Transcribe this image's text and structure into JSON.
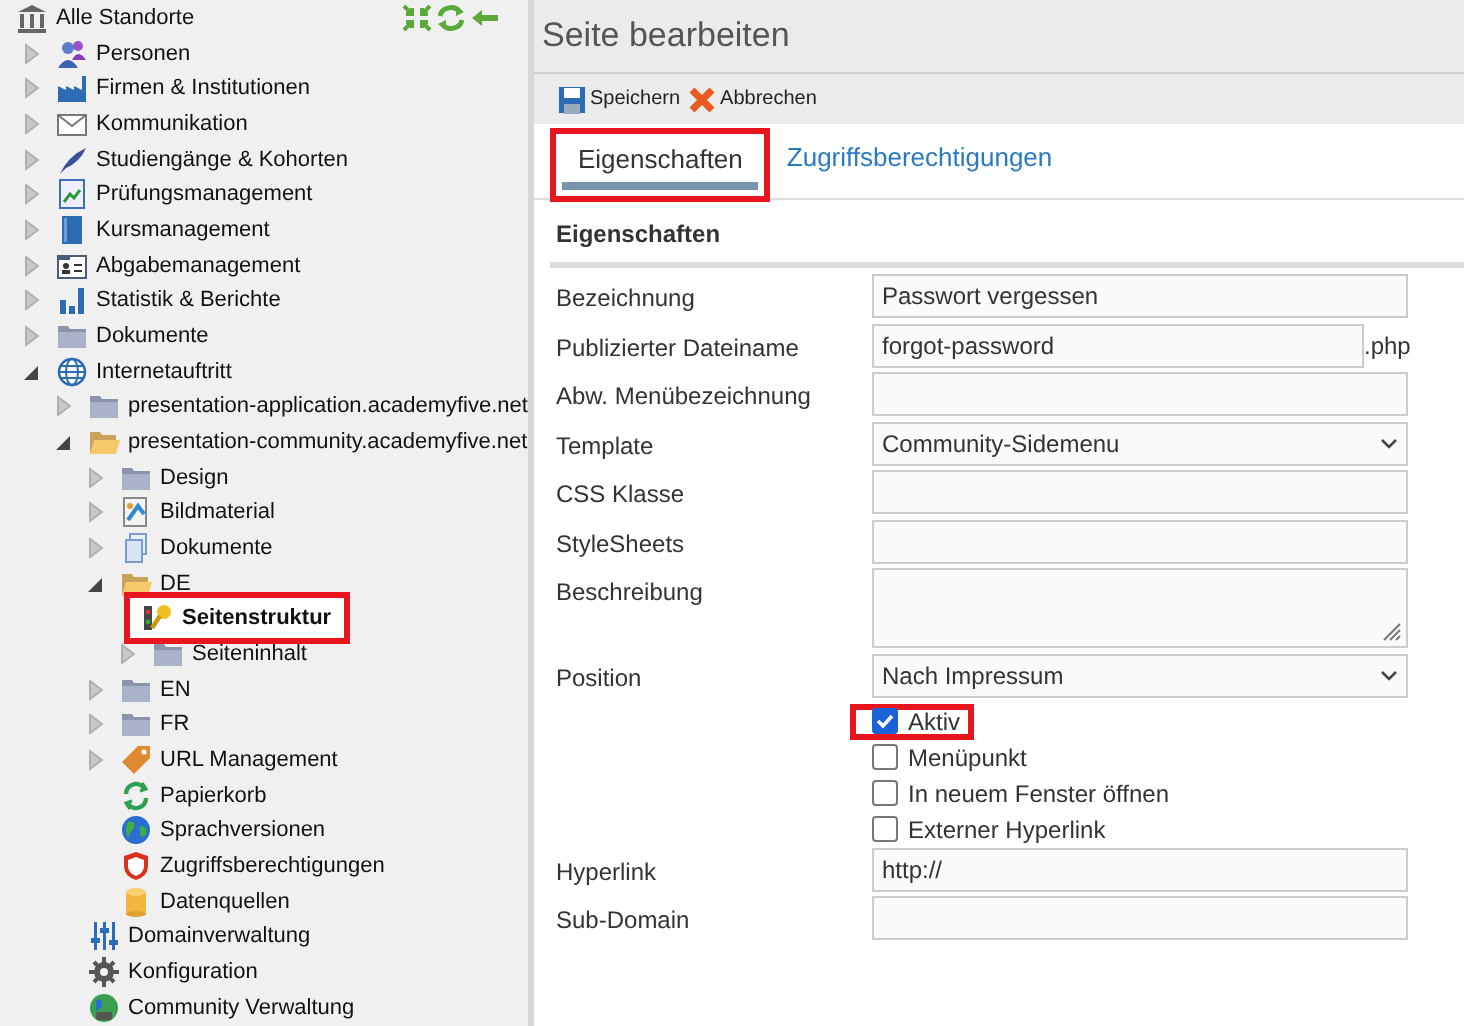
{
  "tree": {
    "label": "Alle Standorte",
    "children": [
      {
        "label": "Personen",
        "expanded": false
      },
      {
        "label": "Firmen & Institutionen",
        "expanded": false
      },
      {
        "label": "Kommunikation",
        "expanded": false
      },
      {
        "label": "Studiengänge & Kohorten",
        "expanded": false
      },
      {
        "label": "Prüfungsmanagement",
        "expanded": false
      },
      {
        "label": "Kursmanagement",
        "expanded": false
      },
      {
        "label": "Abgabemanagement",
        "expanded": false
      },
      {
        "label": "Statistik & Berichte",
        "expanded": false
      },
      {
        "label": "Dokumente",
        "expanded": false
      },
      {
        "label": "Internetauftritt",
        "expanded": true,
        "children": [
          {
            "label": "presentation-application.academyfive.net",
            "expanded": false
          },
          {
            "label": "presentation-community.academyfive.net",
            "expanded": true,
            "children": [
              {
                "label": "Design",
                "expanded": false
              },
              {
                "label": "Bildmaterial",
                "expanded": false
              },
              {
                "label": "Dokumente",
                "expanded": false
              },
              {
                "label": "DE",
                "expanded": true,
                "children": [
                  {
                    "label": "Seitenstruktur",
                    "selected": true,
                    "highlighted": true
                  },
                  {
                    "label": "Seiteninhalt",
                    "selected": false,
                    "expanded": false
                  }
                ]
              },
              {
                "label": "EN",
                "expanded": false
              },
              {
                "label": "FR",
                "expanded": false
              },
              {
                "label": "URL Management",
                "expanded": false
              },
              {
                "label": "Papierkorb"
              },
              {
                "label": "Sprachversionen"
              },
              {
                "label": "Zugriffsberechtigungen"
              },
              {
                "label": "Datenquellen"
              }
            ]
          },
          {
            "label": "Domainverwaltung"
          },
          {
            "label": "Konfiguration"
          },
          {
            "label": "Community Verwaltung"
          }
        ]
      }
    ]
  },
  "title": "Seite bearbeiten",
  "toolbar": [
    "Speichern",
    "Abbrechen"
  ],
  "tabs": [
    {
      "label": "Eigenschaften",
      "selected": true,
      "highlighted": true
    },
    {
      "label": "Zugriffsberechtigungen",
      "selected": false,
      "highlighted": false
    }
  ],
  "section_title": "Eigenschaften",
  "fields": [
    {
      "kind": "text",
      "label": "Bezeichnung",
      "value": "Passwort vergessen"
    },
    {
      "kind": "text",
      "label": "Publizierter Dateiname",
      "value": "forgot-password",
      "suffix": ".php"
    },
    {
      "kind": "text",
      "label": "Abw. Menübezeichnung"
    },
    {
      "kind": "select",
      "label": "Template",
      "value": "Community-Sidemenu"
    },
    {
      "kind": "text",
      "label": "CSS Klasse"
    },
    {
      "kind": "text",
      "label": "StyleSheets"
    },
    {
      "kind": "textarea",
      "label": "Beschreibung"
    },
    {
      "kind": "select",
      "label": "Position",
      "value": "Nach Impressum"
    },
    {
      "kind": "checkboxes",
      "options": [
        {
          "label": "Aktiv",
          "checked": true,
          "highlighted": true
        },
        {
          "label": "Menüpunkt",
          "checked": false,
          "highlighted": false
        },
        {
          "label": "In neuem Fenster öffnen",
          "checked": false,
          "highlighted": false
        },
        {
          "label": "Externer Hyperlink",
          "checked": false,
          "highlighted": false
        }
      ]
    },
    {
      "kind": "text",
      "label": "Hyperlink",
      "value": "http://"
    },
    {
      "kind": "text",
      "label": "Sub-Domain"
    }
  ]
}
